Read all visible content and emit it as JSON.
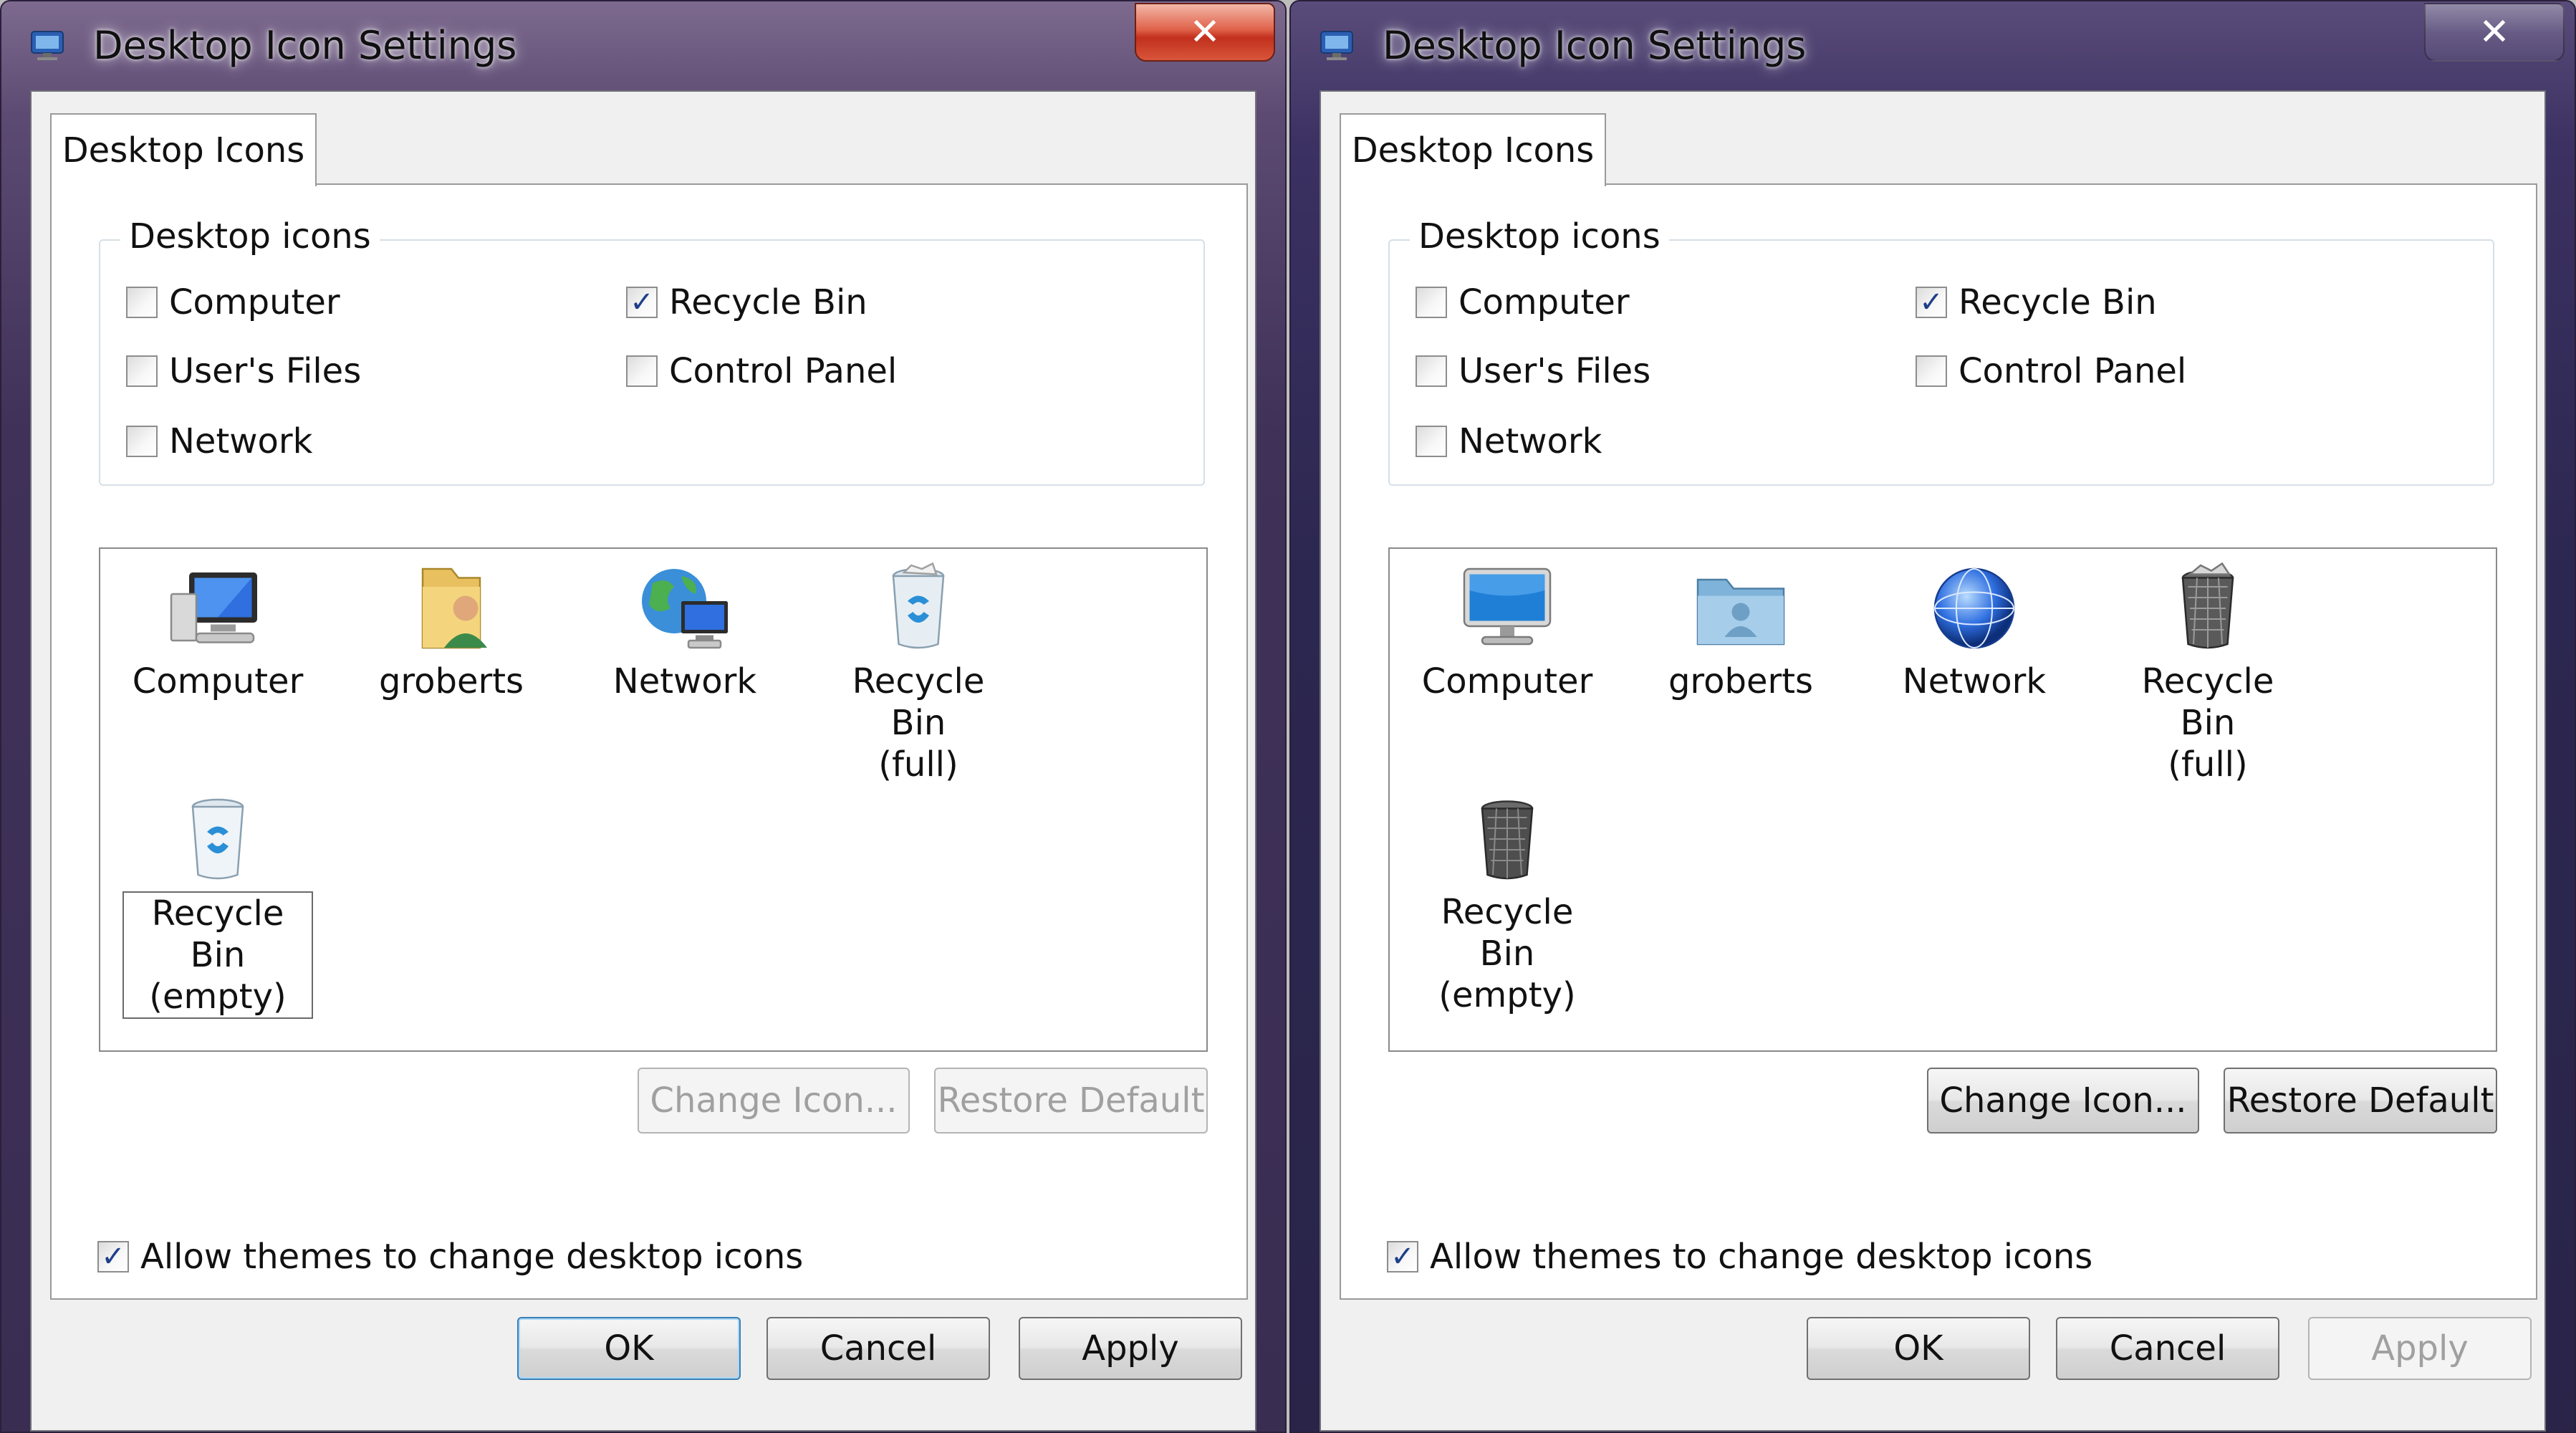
{
  "colors": {
    "title_bar_left": "#5c4a72",
    "title_bar_right": "#3b3162",
    "close_red": "#c1301c",
    "check_blue": "#1d3f8a",
    "default_button_border": "#3c7fb1"
  },
  "windows": [
    {
      "title": "Desktop Icon Settings",
      "close_glyph": "✕",
      "tab_label": "Desktop Icons",
      "group_label": "Desktop icons",
      "checkboxes": [
        {
          "label": "Computer",
          "checked": false
        },
        {
          "label": "Recycle Bin",
          "checked": true
        },
        {
          "label": "User's Files",
          "checked": false
        },
        {
          "label": "Control Panel",
          "checked": false
        },
        {
          "label": "Network",
          "checked": false
        }
      ],
      "icons": [
        {
          "label": "Computer",
          "icon": "monitor-icon"
        },
        {
          "label": "groberts",
          "icon": "user-folder-icon"
        },
        {
          "label": "Network",
          "icon": "globe-network-icon"
        },
        {
          "label": "Recycle Bin (full)",
          "icon": "recycle-bin-full-icon"
        },
        {
          "label": "Recycle Bin (empty)",
          "icon": "recycle-bin-empty-icon",
          "selected": true
        }
      ],
      "change_icon_label": "Change Icon...",
      "restore_default_label": "Restore Default",
      "change_icon_enabled": false,
      "restore_default_enabled": false,
      "allow_themes_label": "Allow themes to change desktop icons",
      "allow_themes_checked": true,
      "ok_label": "OK",
      "cancel_label": "Cancel",
      "apply_label": "Apply",
      "apply_enabled": true
    },
    {
      "title": "Desktop Icon Settings",
      "close_glyph": "✕",
      "tab_label": "Desktop Icons",
      "group_label": "Desktop icons",
      "checkboxes": [
        {
          "label": "Computer",
          "checked": false
        },
        {
          "label": "Recycle Bin",
          "checked": true
        },
        {
          "label": "User's Files",
          "checked": false
        },
        {
          "label": "Control Panel",
          "checked": false
        },
        {
          "label": "Network",
          "checked": false
        }
      ],
      "icons": [
        {
          "label": "Computer",
          "icon": "monitor-icon"
        },
        {
          "label": "groberts",
          "icon": "user-folder-icon"
        },
        {
          "label": "Network",
          "icon": "globe-network-icon"
        },
        {
          "label": "Recycle Bin (full)",
          "icon": "recycle-bin-full-icon"
        },
        {
          "label": "Recycle Bin (empty)",
          "icon": "recycle-bin-empty-icon"
        }
      ],
      "change_icon_label": "Change Icon...",
      "restore_default_label": "Restore Default",
      "change_icon_enabled": true,
      "restore_default_enabled": true,
      "allow_themes_label": "Allow themes to change desktop icons",
      "allow_themes_checked": true,
      "ok_label": "OK",
      "cancel_label": "Cancel",
      "apply_label": "Apply",
      "apply_enabled": false
    }
  ]
}
